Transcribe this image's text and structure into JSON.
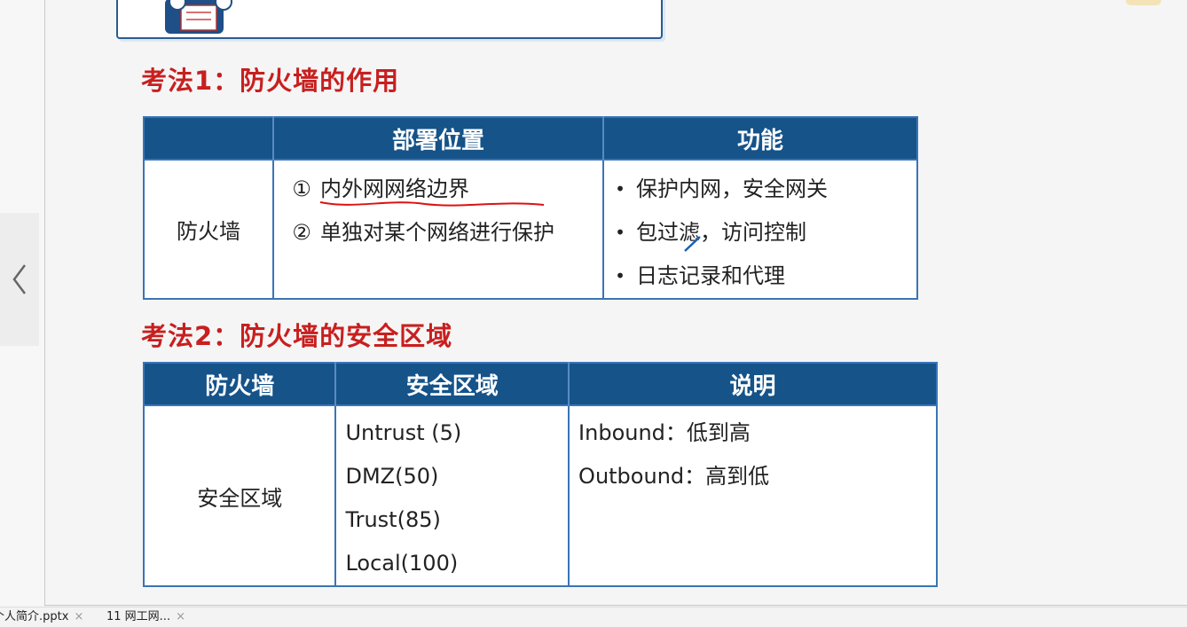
{
  "section1": {
    "title": "考法1：防火墙的作用",
    "headers": [
      "",
      "部署位置",
      "功能"
    ],
    "row_label": "防火墙",
    "positions": [
      {
        "num": "①",
        "text": "内外网网络边界"
      },
      {
        "num": "②",
        "text": "单独对某个网络进行保护"
      }
    ],
    "bullet": "•",
    "functions": [
      "保护内网，安全网关",
      "包过滤，访问控制",
      "日志记录和代理"
    ]
  },
  "section2": {
    "title": "考法2：防火墙的安全区域",
    "headers": [
      "防火墙",
      "安全区域",
      "说明"
    ],
    "row_label": "安全区域",
    "zones": [
      "Untrust (5)",
      "DMZ(50)",
      "Trust(85)",
      "Local(100)"
    ],
    "notes": [
      "Inbound：低到高",
      "Outbound：高到低"
    ]
  },
  "taskbar": {
    "tab1": "个人简介.pptx",
    "tab2": "11 网工网...",
    "close": "×"
  },
  "colors": {
    "header_bg": "#155389",
    "border": "#3a74b6",
    "title_red": "#c81f1f"
  },
  "icons": [
    "chevron-left-icon",
    "close-icon",
    "mascot-illustration",
    "pen-cursor-icon"
  ]
}
